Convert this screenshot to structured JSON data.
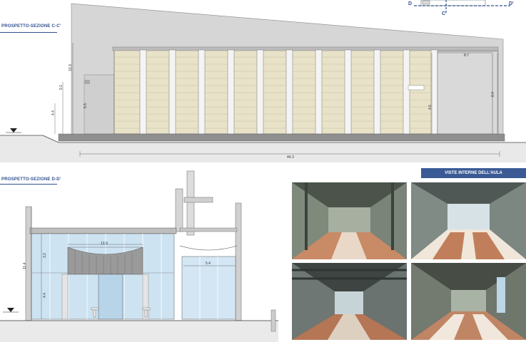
{
  "sections": {
    "top_title": "PROSPETTO-SEZIONE C-C'",
    "bottom_title": "PROSPETTO-SEZIONE D-D'"
  },
  "key_plan": {
    "left_mark": "D",
    "right_mark": "D'",
    "bottom_mark": "C'"
  },
  "top_dimensions": {
    "overall_length": "44.3",
    "right_bay": "8.7",
    "right_height": "8.4",
    "height_total": "13.3",
    "height_mid": "9.1",
    "height_low": "4.4",
    "height_interior": "5.5",
    "height_right_low": "4.6"
  },
  "bottom_dimensions": {
    "window_width": "13.9",
    "right_bay": "5.4",
    "height_total": "11.4",
    "height_upper": "3.2",
    "height_lower": "4.4"
  },
  "gallery": {
    "banner": "VISTE INTERNE DELL'AULA"
  },
  "colors": {
    "accent": "#2f4f8f",
    "banner": "#3a5a95"
  }
}
